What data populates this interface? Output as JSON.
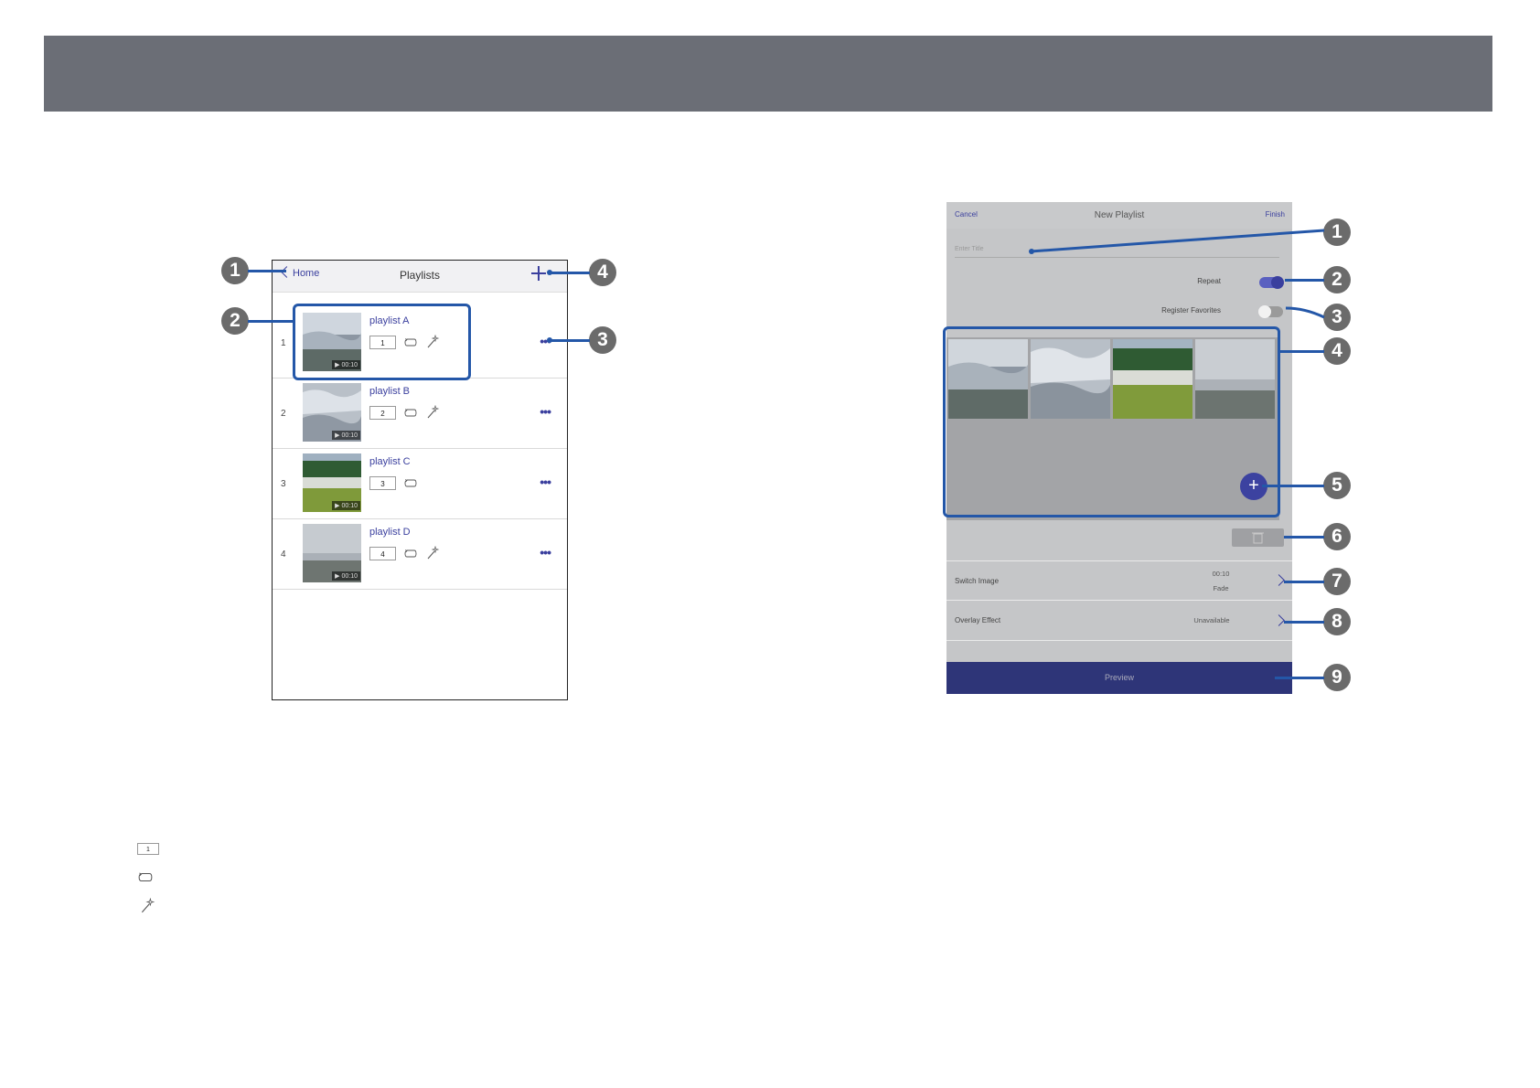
{
  "left_screen": {
    "back_label": "Home",
    "title": "Playlists",
    "rows": [
      {
        "index": "1",
        "name": "playlist A",
        "number": "1",
        "duration": "00:10",
        "favorite": true
      },
      {
        "index": "2",
        "name": "playlist B",
        "number": "2",
        "duration": "00:10",
        "favorite": true
      },
      {
        "index": "3",
        "name": "playlist C",
        "number": "3",
        "duration": "00:10",
        "favorite": false
      },
      {
        "index": "4",
        "name": "playlist D",
        "number": "4",
        "duration": "00:10",
        "favorite": true
      }
    ]
  },
  "right_screen": {
    "cancel_label": "Cancel",
    "title": "New Playlist",
    "finish_label": "Finish",
    "title_placeholder": "Enter Title",
    "repeat_label": "Repeat",
    "repeat_on": true,
    "favorites_label": "Register Favorites",
    "favorites_on": false,
    "switch_image_label": "Switch Image",
    "switch_image_time": "00:10",
    "switch_image_effect": "Fade",
    "overlay_label": "Overlay Effect",
    "overlay_value": "Unavailable",
    "preview_label": "Preview"
  },
  "callouts_left": [
    "1",
    "2",
    "3",
    "4"
  ],
  "callouts_right": [
    "1",
    "2",
    "3",
    "4",
    "5",
    "6",
    "7",
    "8",
    "9"
  ],
  "legend": {
    "number_icon_text": "1"
  },
  "colors": {
    "accent": "#3a3f9e",
    "callout_line": "#2457a8",
    "header_bar": "#6b6e76"
  }
}
